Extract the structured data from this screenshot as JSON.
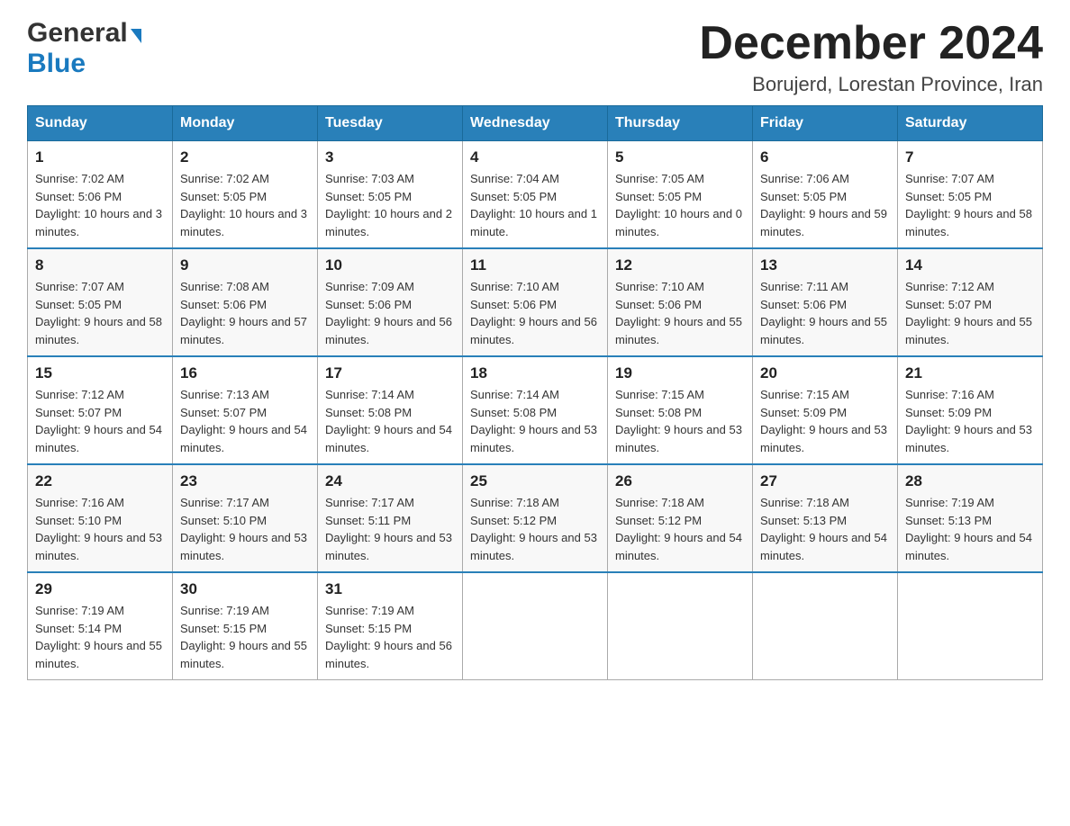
{
  "header": {
    "logo": {
      "general": "General",
      "blue": "Blue",
      "arrow": "▶"
    },
    "title": "December 2024",
    "location": "Borujerd, Lorestan Province, Iran"
  },
  "weekdays": [
    "Sunday",
    "Monday",
    "Tuesday",
    "Wednesday",
    "Thursday",
    "Friday",
    "Saturday"
  ],
  "weeks": [
    [
      {
        "day": "1",
        "sunrise": "7:02 AM",
        "sunset": "5:06 PM",
        "daylight": "10 hours and 3 minutes."
      },
      {
        "day": "2",
        "sunrise": "7:02 AM",
        "sunset": "5:05 PM",
        "daylight": "10 hours and 3 minutes."
      },
      {
        "day": "3",
        "sunrise": "7:03 AM",
        "sunset": "5:05 PM",
        "daylight": "10 hours and 2 minutes."
      },
      {
        "day": "4",
        "sunrise": "7:04 AM",
        "sunset": "5:05 PM",
        "daylight": "10 hours and 1 minute."
      },
      {
        "day": "5",
        "sunrise": "7:05 AM",
        "sunset": "5:05 PM",
        "daylight": "10 hours and 0 minutes."
      },
      {
        "day": "6",
        "sunrise": "7:06 AM",
        "sunset": "5:05 PM",
        "daylight": "9 hours and 59 minutes."
      },
      {
        "day": "7",
        "sunrise": "7:07 AM",
        "sunset": "5:05 PM",
        "daylight": "9 hours and 58 minutes."
      }
    ],
    [
      {
        "day": "8",
        "sunrise": "7:07 AM",
        "sunset": "5:05 PM",
        "daylight": "9 hours and 58 minutes."
      },
      {
        "day": "9",
        "sunrise": "7:08 AM",
        "sunset": "5:06 PM",
        "daylight": "9 hours and 57 minutes."
      },
      {
        "day": "10",
        "sunrise": "7:09 AM",
        "sunset": "5:06 PM",
        "daylight": "9 hours and 56 minutes."
      },
      {
        "day": "11",
        "sunrise": "7:10 AM",
        "sunset": "5:06 PM",
        "daylight": "9 hours and 56 minutes."
      },
      {
        "day": "12",
        "sunrise": "7:10 AM",
        "sunset": "5:06 PM",
        "daylight": "9 hours and 55 minutes."
      },
      {
        "day": "13",
        "sunrise": "7:11 AM",
        "sunset": "5:06 PM",
        "daylight": "9 hours and 55 minutes."
      },
      {
        "day": "14",
        "sunrise": "7:12 AM",
        "sunset": "5:07 PM",
        "daylight": "9 hours and 55 minutes."
      }
    ],
    [
      {
        "day": "15",
        "sunrise": "7:12 AM",
        "sunset": "5:07 PM",
        "daylight": "9 hours and 54 minutes."
      },
      {
        "day": "16",
        "sunrise": "7:13 AM",
        "sunset": "5:07 PM",
        "daylight": "9 hours and 54 minutes."
      },
      {
        "day": "17",
        "sunrise": "7:14 AM",
        "sunset": "5:08 PM",
        "daylight": "9 hours and 54 minutes."
      },
      {
        "day": "18",
        "sunrise": "7:14 AM",
        "sunset": "5:08 PM",
        "daylight": "9 hours and 53 minutes."
      },
      {
        "day": "19",
        "sunrise": "7:15 AM",
        "sunset": "5:08 PM",
        "daylight": "9 hours and 53 minutes."
      },
      {
        "day": "20",
        "sunrise": "7:15 AM",
        "sunset": "5:09 PM",
        "daylight": "9 hours and 53 minutes."
      },
      {
        "day": "21",
        "sunrise": "7:16 AM",
        "sunset": "5:09 PM",
        "daylight": "9 hours and 53 minutes."
      }
    ],
    [
      {
        "day": "22",
        "sunrise": "7:16 AM",
        "sunset": "5:10 PM",
        "daylight": "9 hours and 53 minutes."
      },
      {
        "day": "23",
        "sunrise": "7:17 AM",
        "sunset": "5:10 PM",
        "daylight": "9 hours and 53 minutes."
      },
      {
        "day": "24",
        "sunrise": "7:17 AM",
        "sunset": "5:11 PM",
        "daylight": "9 hours and 53 minutes."
      },
      {
        "day": "25",
        "sunrise": "7:18 AM",
        "sunset": "5:12 PM",
        "daylight": "9 hours and 53 minutes."
      },
      {
        "day": "26",
        "sunrise": "7:18 AM",
        "sunset": "5:12 PM",
        "daylight": "9 hours and 54 minutes."
      },
      {
        "day": "27",
        "sunrise": "7:18 AM",
        "sunset": "5:13 PM",
        "daylight": "9 hours and 54 minutes."
      },
      {
        "day": "28",
        "sunrise": "7:19 AM",
        "sunset": "5:13 PM",
        "daylight": "9 hours and 54 minutes."
      }
    ],
    [
      {
        "day": "29",
        "sunrise": "7:19 AM",
        "sunset": "5:14 PM",
        "daylight": "9 hours and 55 minutes."
      },
      {
        "day": "30",
        "sunrise": "7:19 AM",
        "sunset": "5:15 PM",
        "daylight": "9 hours and 55 minutes."
      },
      {
        "day": "31",
        "sunrise": "7:19 AM",
        "sunset": "5:15 PM",
        "daylight": "9 hours and 56 minutes."
      },
      null,
      null,
      null,
      null
    ]
  ],
  "labels": {
    "sunrise": "Sunrise: ",
    "sunset": "Sunset: ",
    "daylight": "Daylight: "
  }
}
